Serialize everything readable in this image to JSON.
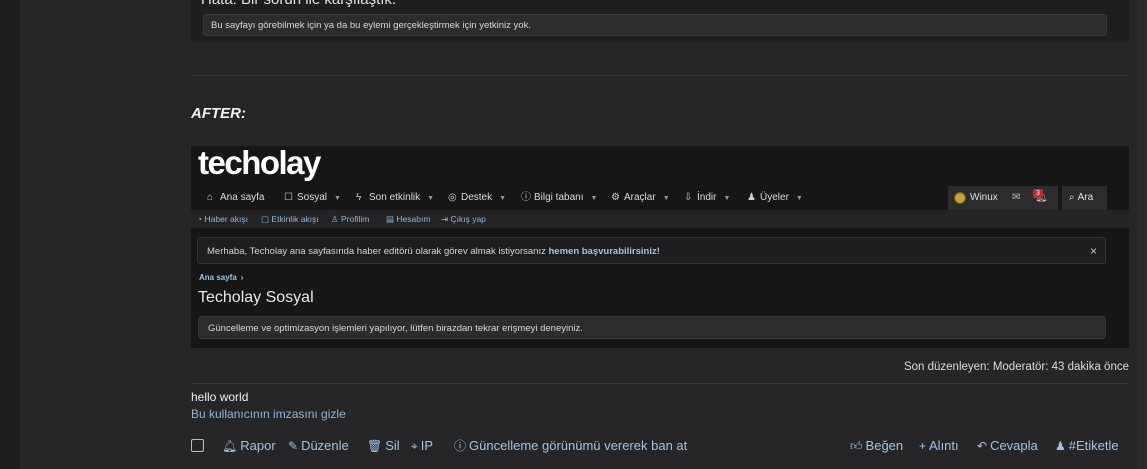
{
  "before": {
    "title": "Hata: Bir sorun ile karşılaştık.",
    "message": "Bu sayfayı görebilmek için ya da bu eylemi gerçekleştirmek için yetkiniz yok."
  },
  "after_label": "AFTER:",
  "screenshot": {
    "logo": "techolay",
    "nav": [
      {
        "icon": "home-icon",
        "glyph": "⌂",
        "label": "Ana sayfa",
        "dropdown": false
      },
      {
        "icon": "chat-icon",
        "glyph": "☐",
        "label": "Sosyal",
        "dropdown": true
      },
      {
        "icon": "bolt-icon",
        "glyph": "ϟ",
        "label": "Son etkinlik",
        "dropdown": true
      },
      {
        "icon": "lifebuoy-icon",
        "glyph": "◎",
        "label": "Destek",
        "dropdown": true
      },
      {
        "icon": "info-icon",
        "glyph": "ⓘ",
        "label": "Bilgi tabanı",
        "dropdown": true
      },
      {
        "icon": "gear-icon",
        "glyph": "⚙",
        "label": "Araçlar",
        "dropdown": true
      },
      {
        "icon": "download-icon",
        "glyph": "⇩",
        "label": "İndir",
        "dropdown": true
      },
      {
        "icon": "users-icon",
        "glyph": "♟",
        "label": "Üyeler",
        "dropdown": true
      }
    ],
    "user": {
      "name": "Winux",
      "alerts_count": "3"
    },
    "search_label": "Ara",
    "subnav": [
      {
        "icon": "rss-icon",
        "label": "Haber akışı"
      },
      {
        "icon": "activity-icon",
        "label": "Etkinlik akışı"
      },
      {
        "icon": "profile-icon",
        "label": "Profilim"
      },
      {
        "icon": "account-icon",
        "label": "Hesabım"
      },
      {
        "icon": "logout-icon",
        "label": "Çıkış yap"
      }
    ],
    "notice_text": "Merhaba, Techolay ana sayfasında haber editörü olarak görev almak istiyorsanız ",
    "notice_link": "hemen başvurabilirsiniz!",
    "breadcrumb": "Ana sayfa",
    "page_title": "Techolay Sosyal",
    "error_message": "Güncelleme ve optimizasyon işlemleri yapılıyor, lütfen birazdan tekrar erişmeyi deneyiniz."
  },
  "last_edit": "Son düzenleyen: Moderatör: 43 dakika önce",
  "signature": {
    "text": "hello world",
    "hide_link": "Bu kullanıcının imzasını gizle"
  },
  "actions_left": [
    {
      "icon": "bell-icon",
      "glyph": "🔔︎",
      "label": "Rapor"
    },
    {
      "icon": "pencil-icon",
      "glyph": "✎",
      "label": "Düzenle"
    },
    {
      "icon": "trash-icon",
      "glyph": "🗑︎",
      "label": "Sil"
    },
    {
      "icon": "crosshair-icon",
      "glyph": "⌖",
      "label": "IP"
    },
    {
      "icon": "warning-icon",
      "glyph": "ⓘ",
      "label": "Güncelleme görünümü vererek ban at"
    }
  ],
  "actions_right": [
    {
      "icon": "thumbs-up-icon",
      "glyph": "👍︎",
      "label": "Beğen"
    },
    {
      "icon": "plus-icon",
      "glyph": "+",
      "label": "Alıntı"
    },
    {
      "icon": "reply-icon",
      "glyph": "↶",
      "label": "Cevapla"
    },
    {
      "icon": "tag-user-icon",
      "glyph": "♟",
      "label": "#Etiketle"
    }
  ]
}
